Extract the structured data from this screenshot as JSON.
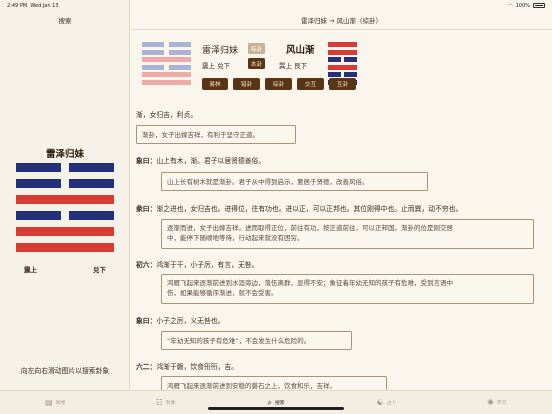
{
  "status": {
    "time": "2:49 PM",
    "date": "Wed Jan 13",
    "battery": "100%"
  },
  "sidebar": {
    "title": "搜索",
    "hexagram_name": "雷泽归妹",
    "upper_label": "震上",
    "lower_label": "兑下",
    "hint": "向左向右滑动图片以搜索卦象"
  },
  "main": {
    "title": "雷泽归妹 → 风山渐（综卦）",
    "left_name": "雷泽归妹",
    "left_tag": "综卦",
    "left_trigrams": "震上 兑下",
    "center_tag": "本卦",
    "right_name": "风山渐",
    "right_trigrams": "巽上 艮下",
    "buttons": [
      "易林",
      "错卦",
      "综卦",
      "交互",
      "互卦"
    ],
    "judgement": "渐，女归吉，利贞。",
    "judgement_note": "渐卦，女子出嫁吉祥，有利于坚守正道。",
    "xiang_label": "象曰：",
    "xiang": "山上有木，渐。君子以居贤德善俗。",
    "xiang_note": "山上长有树木就是渐卦。君子从中得到启示，要居于贤德，改善风俗。",
    "tuan_label": "彖曰：",
    "tuan": "渐之进也，女归吉也。进得位，往有功也。进以正，可以正邦也。其位刚得中也。止而巽，动不穷也。",
    "tuan_note_1": "逐渐而进，女子出嫁吉祥。进而取得正位，前往有功，按正道前往，可以正邦国。渐卦的位是刚交居",
    "tuan_note_2": "中，能停下随顺地等待，行动起来就没有困穷。",
    "line1_label": "初六：",
    "line1": "鸿渐于干，小子厉，有言，无咎。",
    "line1_note_1": "鸿雁飞起来逐渐前进到水涯旁边，落伍离群，显得不安；象征着年幼无知的孩子有危难，受到言语中",
    "line1_note_2": "伤，如果能够循序渐进，就不会受害。",
    "line1_xiang_label": "象曰：",
    "line1_xiang": "小子之厉，义无咎也。",
    "line1_xiang_note": "“年幼无知的孩子有危难”，不会发生什么危险的。",
    "line2_label": "六二：",
    "line2": "鸿渐于磐，饮食衎衎，吉。",
    "line2_note_partial": "鸿雁飞起来逐渐前进到安稳的磐石之上，饮食和乐，吉祥。"
  },
  "tabs": [
    {
      "label": "易经",
      "icon": "book-icon",
      "active": false
    },
    {
      "label": "卦象",
      "icon": "hexagram-icon",
      "active": false
    },
    {
      "label": "搜索",
      "icon": "search-icon",
      "active": true
    },
    {
      "label": "占卜",
      "icon": "yin-yang-icon",
      "active": false
    },
    {
      "label": "学习",
      "icon": "lightbulb-icon",
      "active": false
    }
  ],
  "colors": {
    "red": "#d83a36",
    "blue": "#23307a",
    "brown": "#5a3414"
  }
}
